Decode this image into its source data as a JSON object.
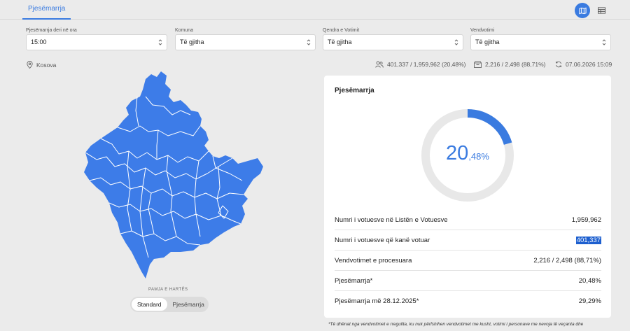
{
  "tabs": {
    "active_label": "Pjesëmarrja"
  },
  "view_toggle": {
    "map_icon": "map-icon",
    "table_icon": "table-icon",
    "accent": "#3a7be0"
  },
  "filters": [
    {
      "label": "Pjesëmarrja deri në ora",
      "value": "15:00"
    },
    {
      "label": "Komuna",
      "value": "Të gjitha"
    },
    {
      "label": "Qendra e Votimit",
      "value": "Të gjitha"
    },
    {
      "label": "Vendvotimi",
      "value": "Të gjitha"
    }
  ],
  "location": {
    "icon": "location-pin-icon",
    "label": "Kosova"
  },
  "summary": {
    "voters": "401,337 / 1,959,962 (20,48%)",
    "stations": "2,216 / 2,498 (88,71%)",
    "updated": "07.06.2026 15:09"
  },
  "map": {
    "fill_color": "#3d7ce8",
    "label": "PAMJA E HARTËS",
    "toggle": [
      "Standard",
      "Pjesëmarrja"
    ],
    "selected_toggle": "Standard"
  },
  "card": {
    "title": "Pjesëmarrja",
    "donut": {
      "percent": 20.48,
      "integer_text": "20",
      "decimal_text": ",48%"
    },
    "rows": [
      {
        "label": "Numri i votuesve në Listën e Votuesve",
        "value": "1,959,962"
      },
      {
        "label": "Numri i votuesve që kanë votuar",
        "value": "401,337",
        "selected": true
      },
      {
        "label": "Vendvotimet e procesuara",
        "value": "2,216 / 2,498 (88,71%)"
      },
      {
        "label": "Pjesëmarrja*",
        "value": "20,48%"
      },
      {
        "label": "Pjesëmarrja më 28.12.2025*",
        "value": "29,29%"
      }
    ]
  },
  "footnote": "*Të dhënat nga vendvotimet e rregullta, ku nuk përfshihen vendvotimet me kusht, votimi i personave me nevoja të veçanta dhe"
}
